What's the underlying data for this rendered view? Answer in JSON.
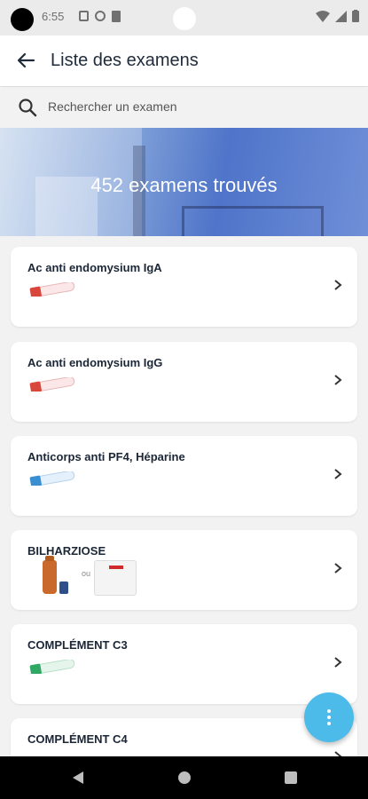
{
  "status_bar": {
    "time": "6:55"
  },
  "app_bar": {
    "title": "Liste des examens",
    "back_icon": "arrow-back-icon"
  },
  "search": {
    "placeholder": "Rechercher un examen",
    "icon": "search-icon"
  },
  "banner": {
    "text": "452 examens trouvés"
  },
  "exams": [
    {
      "name": "Ac anti endomysium IgA",
      "tube_color": "#d9473c"
    },
    {
      "name": "Ac anti endomysium IgG",
      "tube_color": "#d9473c"
    },
    {
      "name": "Anticorps anti PF4,  Héparine",
      "tube_color": "#3a8fd1"
    },
    {
      "name": "BILHARZIOSE",
      "or_label": "ou"
    },
    {
      "name": "COMPLÉMENT C3",
      "tube_color": "#2fa866"
    },
    {
      "name": "COMPLÉMENT C4"
    }
  ],
  "fab": {
    "icon": "more-vertical-icon",
    "color": "#4dbbe9"
  }
}
